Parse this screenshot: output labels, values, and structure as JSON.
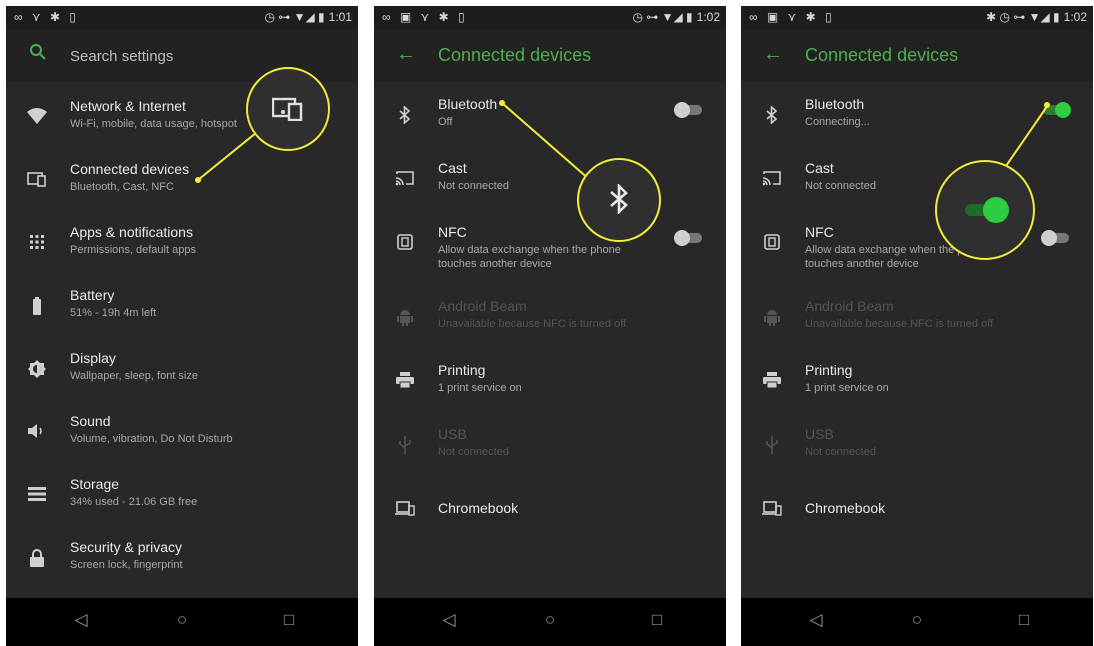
{
  "panel1": {
    "status_left": "∞ ⋎ ✱ ▯",
    "status_right": "◷ ⊶ ▼◢ ▮",
    "time": "1:01",
    "search_placeholder": "Search settings",
    "items": [
      {
        "title": "Network & Internet",
        "subtitle": "Wi-Fi, mobile, data usage, hotspot",
        "icon": "wifi-icon"
      },
      {
        "title": "Connected devices",
        "subtitle": "Bluetooth, Cast, NFC",
        "icon": "devices-icon"
      },
      {
        "title": "Apps & notifications",
        "subtitle": "Permissions, default apps",
        "icon": "apps-icon"
      },
      {
        "title": "Battery",
        "subtitle": "51% - 19h 4m left",
        "icon": "battery-icon"
      },
      {
        "title": "Display",
        "subtitle": "Wallpaper, sleep, font size",
        "icon": "display-icon"
      },
      {
        "title": "Sound",
        "subtitle": "Volume, vibration, Do Not Disturb",
        "icon": "sound-icon"
      },
      {
        "title": "Storage",
        "subtitle": "34% used - 21.06 GB free",
        "icon": "storage-icon"
      },
      {
        "title": "Security & privacy",
        "subtitle": "Screen lock, fingerprint",
        "icon": "lock-icon"
      }
    ]
  },
  "panel2": {
    "status_left": "∞ ▣ ⋎ ✱ ▯",
    "status_right": "◷ ⊶ ▼◢ ▮",
    "time": "1:02",
    "title": "Connected devices",
    "items": [
      {
        "title": "Bluetooth",
        "subtitle": "Off",
        "icon": "bluetooth-icon",
        "toggle": "off"
      },
      {
        "title": "Cast",
        "subtitle": "Not connected",
        "icon": "cast-icon"
      },
      {
        "title": "NFC",
        "subtitle": "Allow data exchange when the phone touches another device",
        "subtitle1": "Allow data exchange when the phone",
        "subtitle2": "touches another device",
        "icon": "nfc-icon",
        "toggle": "off"
      },
      {
        "title": "Android Beam",
        "subtitle": "Unavailable because NFC is turned off",
        "icon": "android-icon",
        "disabled": true
      },
      {
        "title": "Printing",
        "subtitle": "1 print service on",
        "icon": "print-icon"
      },
      {
        "title": "USB",
        "subtitle": "Not connected",
        "icon": "usb-icon",
        "disabled": true
      },
      {
        "title": "Chromebook",
        "subtitle": "",
        "icon": "chromebook-icon"
      }
    ]
  },
  "panel3": {
    "status_left": "∞ ▣ ⋎ ✱ ▯",
    "status_right": "✱ ◷ ⊶ ▼◢ ▮",
    "time": "1:02",
    "title": "Connected devices",
    "items": [
      {
        "title": "Bluetooth",
        "subtitle": "Connecting...",
        "icon": "bluetooth-icon",
        "toggle": "on"
      },
      {
        "title": "Cast",
        "subtitle": "Not connected",
        "icon": "cast-icon"
      },
      {
        "title": "NFC",
        "subtitle1": "Allow data exchange when the phone",
        "subtitle2": "touches another device",
        "icon": "nfc-icon",
        "toggle": "off"
      },
      {
        "title": "Android Beam",
        "subtitle": "Unavailable because NFC is turned off",
        "icon": "android-icon",
        "disabled": true
      },
      {
        "title": "Printing",
        "subtitle": "1 print service on",
        "icon": "print-icon"
      },
      {
        "title": "USB",
        "subtitle": "Not connected",
        "icon": "usb-icon",
        "disabled": true
      },
      {
        "title": "Chromebook",
        "subtitle": "",
        "icon": "chromebook-icon"
      }
    ]
  },
  "glyphs": {
    "back": "◁",
    "home": "○",
    "recent": "□",
    "arrow_left": "←",
    "search": "⚲"
  },
  "colors": {
    "accent": "#4caf50",
    "callout": "#f4ec3a",
    "toggle_on": "#2ecc40",
    "background": "#282828"
  }
}
